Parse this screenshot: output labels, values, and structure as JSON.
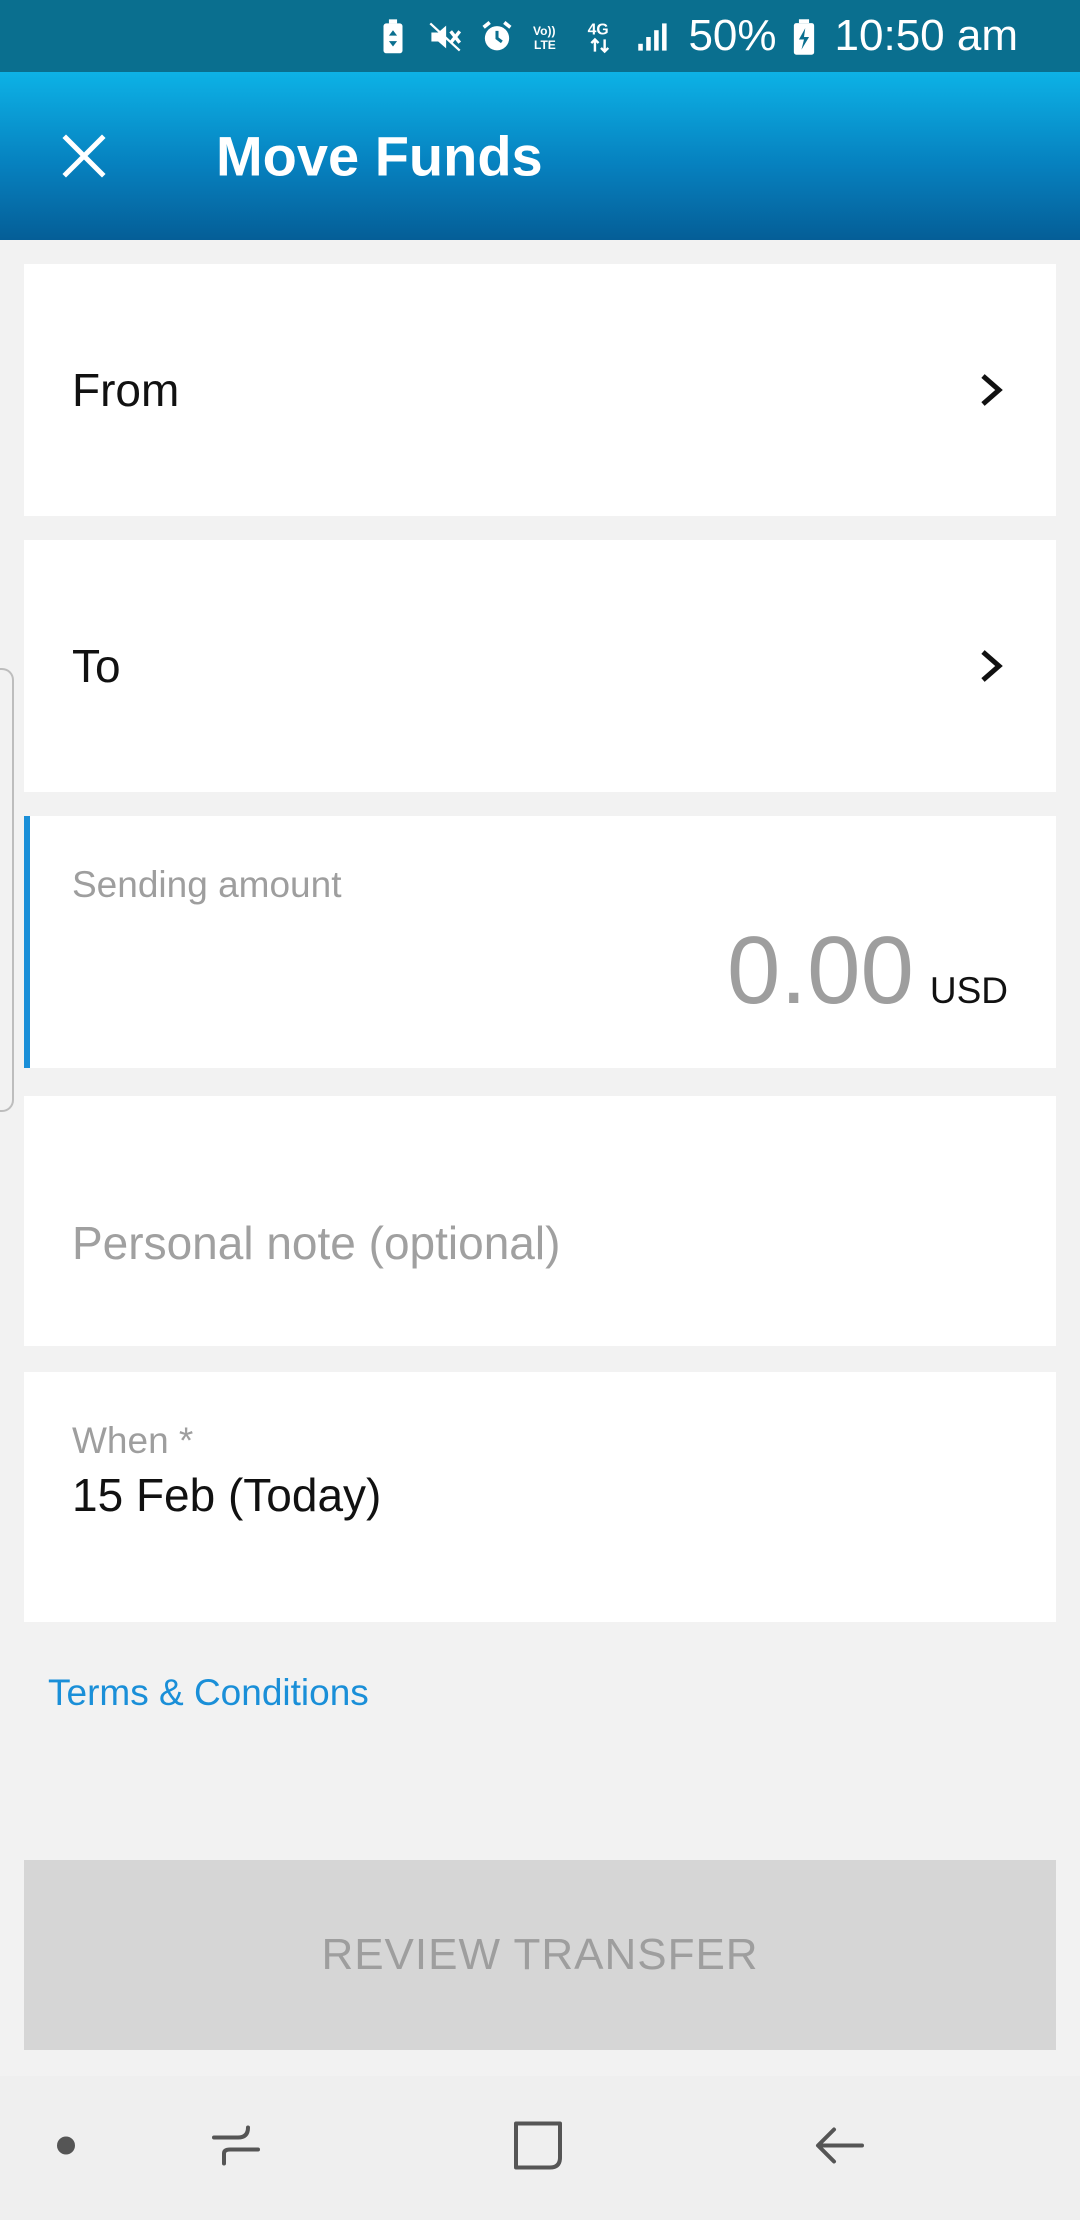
{
  "status_bar": {
    "battery": "50%",
    "time": "10:50 am",
    "icons": [
      "battery-saver-icon",
      "mute-icon",
      "alarm-icon",
      "volte-icon",
      "network-4g-icon",
      "signal-icon",
      "battery-icon"
    ]
  },
  "header": {
    "title": "Move Funds",
    "close_icon": "close-icon"
  },
  "form": {
    "from_label": "From",
    "to_label": "To",
    "amount_label": "Sending amount",
    "amount_value": "0.00",
    "currency": "USD",
    "note_placeholder": "Personal note (optional)",
    "note_value": "",
    "when_label": "When *",
    "when_value": "15 Feb (Today)"
  },
  "links": {
    "terms": "Terms & Conditions"
  },
  "actions": {
    "review_label": "REVIEW TRANSFER"
  },
  "nav_bar": {
    "items": [
      "dot-icon",
      "recent-apps-icon",
      "home-icon",
      "back-icon"
    ]
  },
  "colors": {
    "status_bar": "#0a6f8f",
    "header_top": "#0db2e6",
    "header_bottom": "#055e97",
    "accent": "#1a8fd8",
    "disabled_button": "#d6d6d6"
  }
}
